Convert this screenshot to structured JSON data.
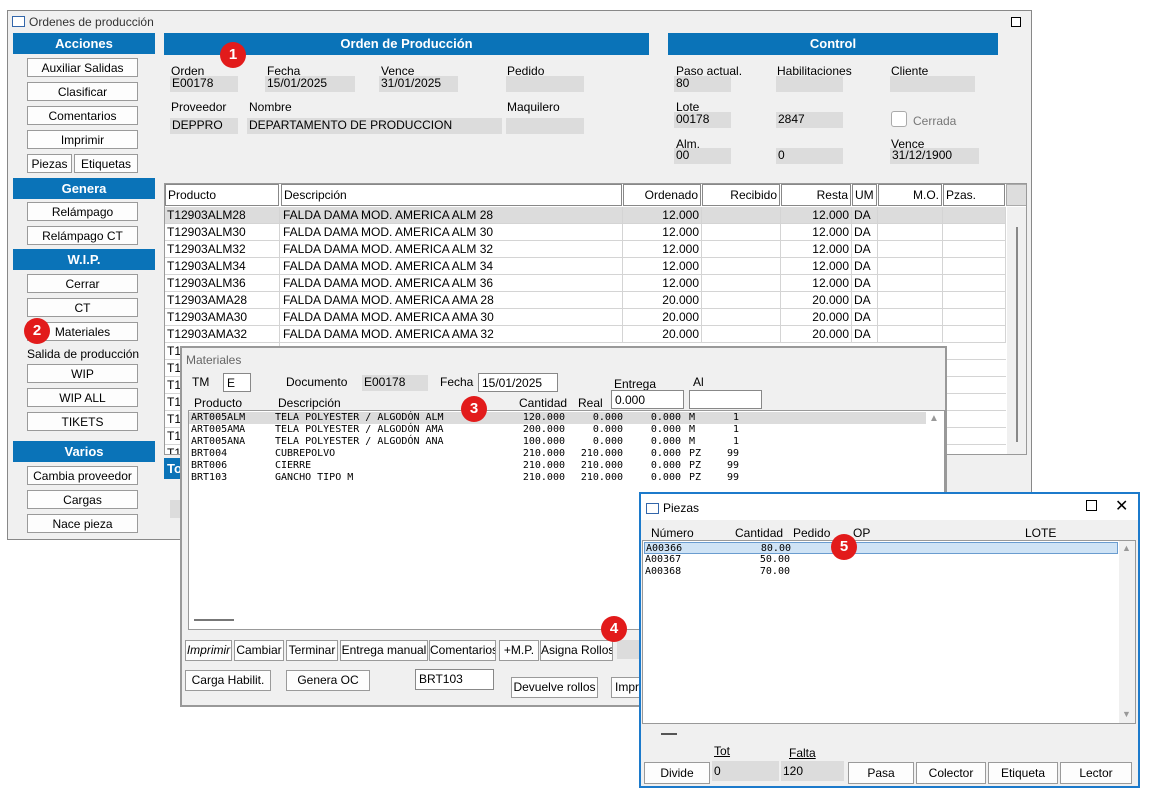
{
  "main_window": {
    "title": "Ordenes de producción"
  },
  "sidebar": {
    "acciones": {
      "title": "Acciones",
      "buttons": [
        "Auxiliar Salidas",
        "Clasificar",
        "Comentarios",
        "Imprimir"
      ],
      "piezas": "Piezas",
      "etiquetas": "Etiquetas"
    },
    "genera": {
      "title": "Genera",
      "buttons": [
        "Relámpago",
        "Relámpago CT"
      ]
    },
    "wip": {
      "title": "W.I.P.",
      "buttons": [
        "Cerrar",
        "CT",
        "Materiales"
      ],
      "salida_label": "Salida de producción",
      "buttons2": [
        "WIP",
        "WIP ALL",
        "TIKETS"
      ]
    },
    "varios": {
      "title": "Varios",
      "buttons": [
        "Cambia proveedor",
        "Cargas",
        "Nace pieza"
      ]
    }
  },
  "orden": {
    "title": "Orden de Producción",
    "orden_label": "Orden",
    "orden_value": "E00178",
    "fecha_label": "Fecha",
    "fecha_value": "15/01/2025",
    "vence_label": "Vence",
    "vence_value": "31/01/2025",
    "pedido_label": "Pedido",
    "pedido_value": "",
    "proveedor_label": "Proveedor",
    "proveedor_value": "DEPPRO",
    "nombre_label": "Nombre",
    "nombre_value": "DEPARTAMENTO  DE PRODUCCION",
    "maquilero_label": "Maquilero",
    "maquilero_value": ""
  },
  "control": {
    "title": "Control",
    "paso_label": "Paso actual.",
    "paso_value": "80",
    "habil_label": "Habilitaciones",
    "habil_value": "",
    "cliente_label": "Cliente",
    "cliente_value": "",
    "lote_label": "Lote",
    "lote_value": "00178",
    "lote2_value": "2847",
    "cerrada_label": "Cerrada",
    "alm_label": "Alm.",
    "alm_value": "00",
    "alm2_value": "0",
    "vence_label": "Vence",
    "vence_value": "31/12/1900"
  },
  "products_table": {
    "headers": [
      "Producto",
      "Descripción",
      "Ordenado",
      "Recibido",
      "Resta",
      "UM",
      "M.O.",
      "Pzas."
    ],
    "rows": [
      [
        "T12903ALM28",
        "FALDA DAMA MOD. AMERICA ALM 28",
        "12.000",
        "",
        "12.000",
        "DA",
        "",
        ""
      ],
      [
        "T12903ALM30",
        "FALDA DAMA MOD. AMERICA ALM 30",
        "12.000",
        "",
        "12.000",
        "DA",
        "",
        ""
      ],
      [
        "T12903ALM32",
        "FALDA DAMA MOD. AMERICA ALM 32",
        "12.000",
        "",
        "12.000",
        "DA",
        "",
        ""
      ],
      [
        "T12903ALM34",
        "FALDA DAMA MOD. AMERICA ALM 34",
        "12.000",
        "",
        "12.000",
        "DA",
        "",
        ""
      ],
      [
        "T12903ALM36",
        "FALDA DAMA MOD. AMERICA ALM 36",
        "12.000",
        "",
        "12.000",
        "DA",
        "",
        ""
      ],
      [
        "T12903AMA28",
        "FALDA DAMA MOD. AMERICA AMA 28",
        "20.000",
        "",
        "20.000",
        "DA",
        "",
        ""
      ],
      [
        "T12903AMA30",
        "FALDA DAMA MOD. AMERICA AMA 30",
        "20.000",
        "",
        "20.000",
        "DA",
        "",
        ""
      ],
      [
        "T12903AMA32",
        "FALDA DAMA MOD. AMERICA AMA 32",
        "20.000",
        "",
        "20.000",
        "DA",
        "",
        ""
      ]
    ],
    "partial_rows": [
      "T1",
      "T1",
      "T1",
      "T1",
      "T1",
      "T1",
      "T1"
    ],
    "footer_partial": "To"
  },
  "materiales": {
    "title": "Materiales",
    "tm_label": "TM",
    "tm_value": "E",
    "documento_label": "Documento",
    "documento_value": "E00178",
    "fecha_label": "Fecha",
    "fecha_value": "15/01/2025",
    "entrega_label": "Entrega",
    "entrega_value": "0.000",
    "al_label": "Al",
    "al_value": "",
    "headers": [
      "Producto",
      "Descripción",
      "Cantidad",
      "Real"
    ],
    "rows": [
      [
        "ART005ALM",
        "TELA POLYESTER / ALGODÓN ALM",
        "120.000",
        "0.000",
        "0.000",
        "M",
        "1"
      ],
      [
        "ART005AMA",
        "TELA POLYESTER / ALGODÓN AMA",
        "200.000",
        "0.000",
        "0.000",
        "M",
        "1"
      ],
      [
        "ART005ANA",
        "TELA POLYESTER / ALGODÓN ANA",
        "100.000",
        "0.000",
        "0.000",
        "M",
        "1"
      ],
      [
        "BRT004",
        "CUBREPOLVO",
        "210.000",
        "210.000",
        "0.000",
        "PZ",
        "99"
      ],
      [
        "BRT006",
        "CIERRE",
        "210.000",
        "210.000",
        "0.000",
        "PZ",
        "99"
      ],
      [
        "BRT103",
        "GANCHO TIPO M",
        "210.000",
        "210.000",
        "0.000",
        "PZ",
        "99"
      ]
    ],
    "buttons": [
      "Imprimir",
      "Cambiar",
      "Terminar",
      "Entrega manual",
      "Comentarios",
      "+M.P.",
      "Asigna Rollos"
    ],
    "carga_habil": "Carga Habilit.",
    "genera_oc": "Genera OC",
    "code_value": "BRT103",
    "devuelve": "Devuelve rollos",
    "impr_partial": "Impr"
  },
  "piezas": {
    "title": "Piezas",
    "headers": [
      "Número",
      "Cantidad",
      "Pedido",
      "OP",
      "LOTE"
    ],
    "rows": [
      [
        "A00366",
        "80.00"
      ],
      [
        "A00367",
        "50.00"
      ],
      [
        "A00368",
        "70.00"
      ]
    ],
    "tot_label": "Tot",
    "falta_label": "Falta",
    "divide": "Divide",
    "tot_value": "0",
    "falta_value": "120",
    "buttons": [
      "Pasa",
      "Colector",
      "Etiqueta",
      "Lector"
    ]
  },
  "badges": [
    "1",
    "2",
    "3",
    "4",
    "5"
  ]
}
